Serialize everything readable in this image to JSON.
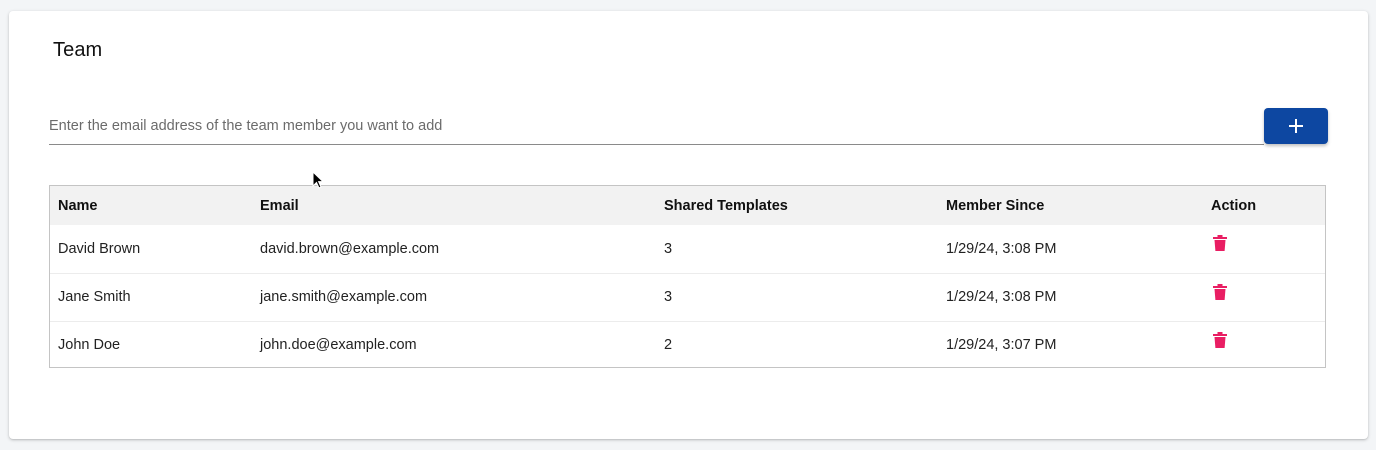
{
  "page": {
    "title": "Team"
  },
  "add_member": {
    "placeholder": "Enter the email address of the team member you want to add",
    "value": "",
    "button_icon": "plus-icon",
    "button_color": "#0d47a1"
  },
  "table": {
    "headers": {
      "name": "Name",
      "email": "Email",
      "shared_templates": "Shared Templates",
      "member_since": "Member Since",
      "action": "Action"
    },
    "rows": [
      {
        "name": "David Brown",
        "email": "david.brown@example.com",
        "shared_templates": "3",
        "member_since": "1/29/24, 3:08 PM",
        "action_icon": "trash-icon"
      },
      {
        "name": "Jane Smith",
        "email": "jane.smith@example.com",
        "shared_templates": "3",
        "member_since": "1/29/24, 3:08 PM",
        "action_icon": "trash-icon"
      },
      {
        "name": "John Doe",
        "email": "john.doe@example.com",
        "shared_templates": "2",
        "member_since": "1/29/24, 3:07 PM",
        "action_icon": "trash-icon"
      }
    ],
    "delete_icon_color": "#e91e63"
  }
}
